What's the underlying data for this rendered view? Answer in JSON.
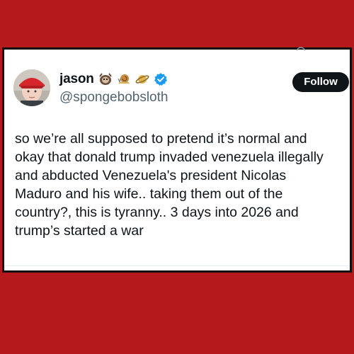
{
  "tweet": {
    "display_name": "jason",
    "handle": "@spongebobsloth",
    "follow_label": "Follow",
    "text": "so we’re all supposed to pretend it’s normal and\nokay that donald trump invaded venezuela illegally\nand abducted Venezuela's president Nicolas\nMaduro and his wife.. taking them out of the\ncountry?, this is tyranny.. 3 days into 2026 and\ntrump’s started a war"
  },
  "icons": {
    "name_emojis": [
      "sloth-emoji-icon",
      "snail-emoji-icon",
      "ringed-planet-emoji-icon"
    ],
    "verified": "verified-badge-icon",
    "verified_color": "#1d9bf0"
  },
  "colors": {
    "background": "#b5191c",
    "card": "#ffffff",
    "follow_button": "#0f1419"
  }
}
